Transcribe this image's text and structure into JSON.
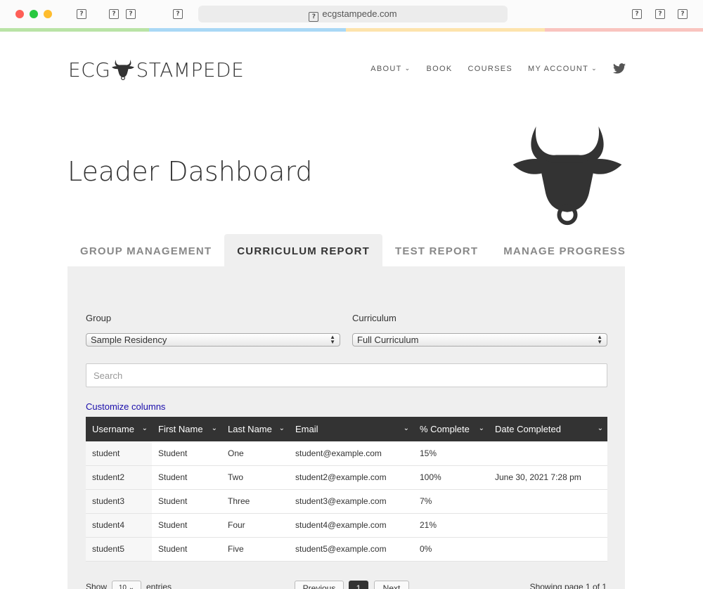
{
  "browser": {
    "url": "ecgstampede.com"
  },
  "header": {
    "logo_left": "ECG",
    "logo_right": "STAMPEDE",
    "nav": [
      {
        "label": "ABOUT",
        "chevron": true
      },
      {
        "label": "BOOK",
        "chevron": false
      },
      {
        "label": "COURSES",
        "chevron": false
      },
      {
        "label": "MY ACCOUNT",
        "chevron": true
      }
    ]
  },
  "page": {
    "title": "Leader Dashboard"
  },
  "tabs": [
    "GROUP MANAGEMENT",
    "CURRICULUM REPORT",
    "TEST REPORT",
    "MANAGE PROGRESS"
  ],
  "active_tab": 1,
  "filters": {
    "group_label": "Group",
    "group_value": "Sample Residency",
    "curriculum_label": "Curriculum",
    "curriculum_value": "Full Curriculum"
  },
  "search": {
    "placeholder": "Search"
  },
  "customize_label": "Customize columns",
  "table": {
    "columns": [
      "Username",
      "First Name",
      "Last Name",
      "Email",
      "% Complete",
      "Date Completed"
    ],
    "rows": [
      [
        "student",
        "Student",
        "One",
        "student@example.com",
        "15%",
        ""
      ],
      [
        "student2",
        "Student",
        "Two",
        "student2@example.com",
        "100%",
        "June 30, 2021 7:28 pm"
      ],
      [
        "student3",
        "Student",
        "Three",
        "student3@example.com",
        "7%",
        ""
      ],
      [
        "student4",
        "Student",
        "Four",
        "student4@example.com",
        "21%",
        ""
      ],
      [
        "student5",
        "Student",
        "Five",
        "student5@example.com",
        "0%",
        ""
      ]
    ]
  },
  "footer": {
    "show_label": "Show",
    "entries_value": "10",
    "entries_label": "entries",
    "previous": "Previous",
    "current_page": "1",
    "next": "Next",
    "showing": "Showing page 1 of 1"
  },
  "colors": {
    "rainbow": [
      "#b9e3a6",
      "#a9d8f5",
      "#fde3ac",
      "#f9c4bf"
    ],
    "header_dark": "#333333",
    "link": "#1a0dab"
  }
}
